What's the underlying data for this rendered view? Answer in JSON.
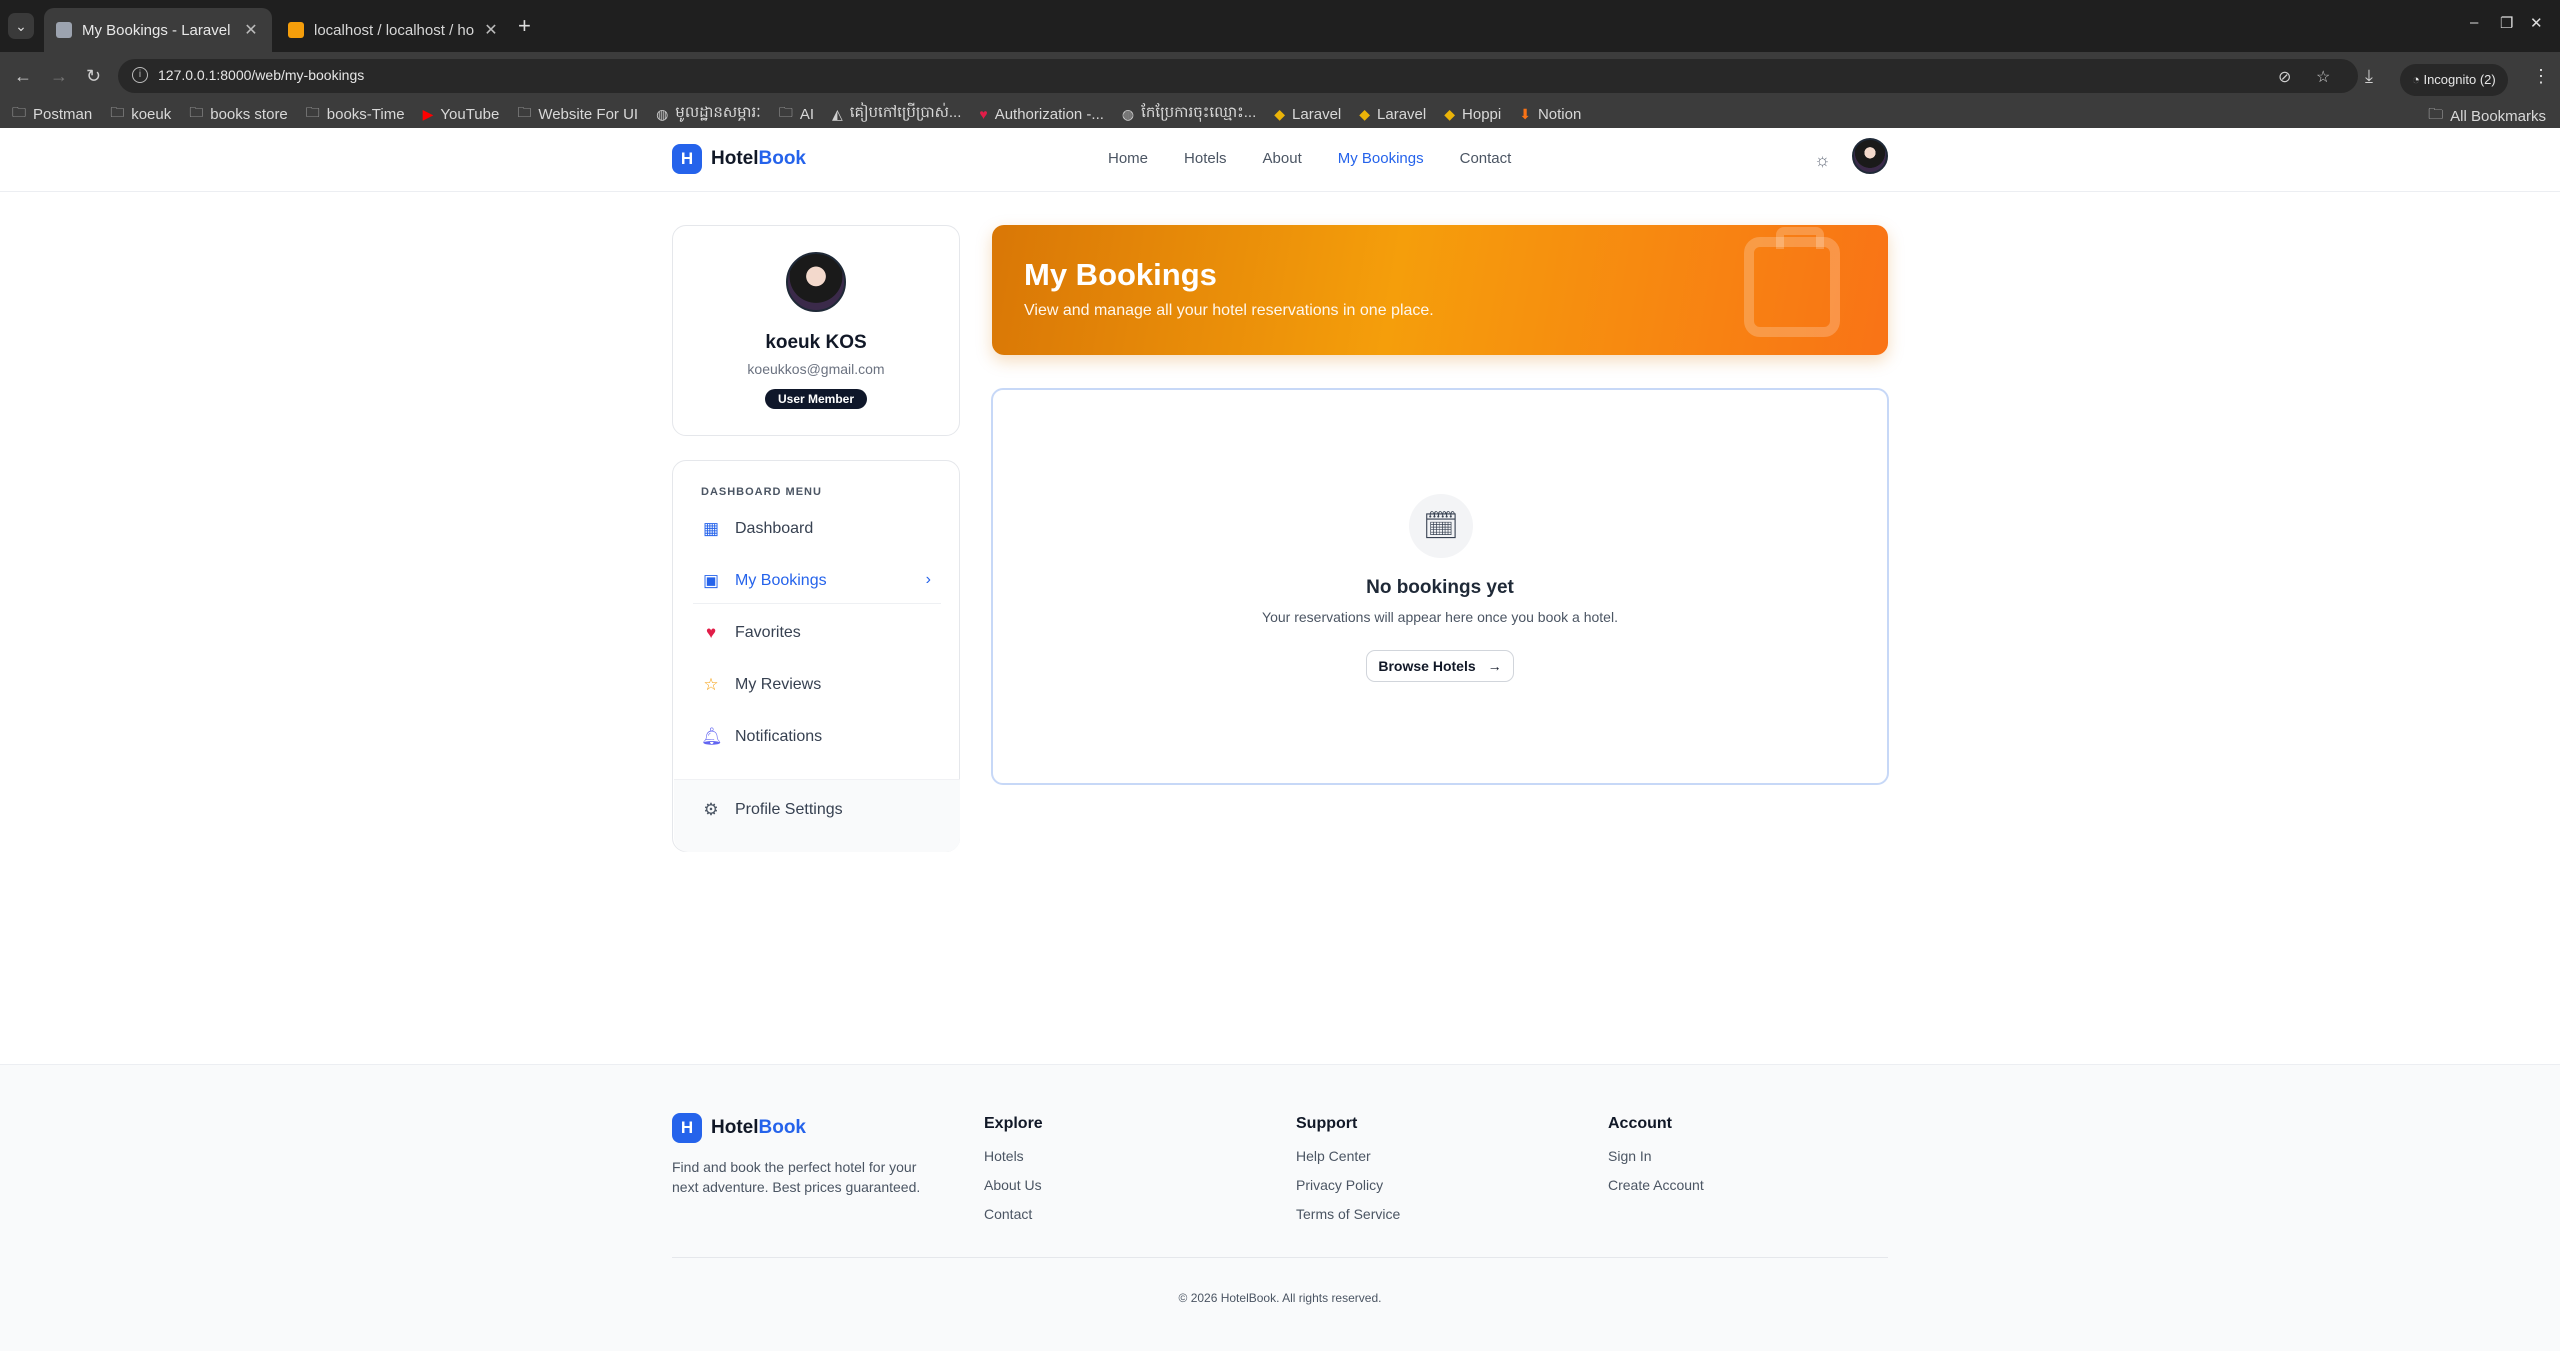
{
  "browser": {
    "tabs": [
      {
        "title": "My Bookings - Laravel",
        "active": true
      },
      {
        "title": "localhost / localhost / ho",
        "active": false
      }
    ],
    "url": "127.0.0.1:8000/web/my-bookings",
    "incognito_label": "Incognito (2)",
    "bookmarks": [
      {
        "label": "Postman",
        "icon": "folder-icon"
      },
      {
        "label": "koeuk",
        "icon": "folder-icon"
      },
      {
        "label": "books store",
        "icon": "folder-icon"
      },
      {
        "label": "books-Time",
        "icon": "folder-icon"
      },
      {
        "label": "YouTube",
        "icon": "youtube-icon"
      },
      {
        "label": "Website For UI",
        "icon": "folder-icon"
      },
      {
        "label": "មូលដ្ឋានសម្ភារៈ",
        "icon": "globe-icon"
      },
      {
        "label": "AI",
        "icon": "folder-icon"
      },
      {
        "label": "គៀបកៅប្រើប្រាស់...",
        "icon": "drive-icon"
      },
      {
        "label": "Authorization -...",
        "icon": "heart-icon"
      },
      {
        "label": "កែប្រែការចុះឈ្មោះ...",
        "icon": "globe-icon"
      },
      {
        "label": "Laravel",
        "icon": "laravel-icon"
      },
      {
        "label": "Laravel",
        "icon": "laravel-icon"
      },
      {
        "label": "Hoppi",
        "icon": "laravel-icon"
      },
      {
        "label": "Notion",
        "icon": "download-icon"
      }
    ],
    "all_bookmarks_label": "All Bookmarks"
  },
  "header": {
    "logo_letter": "H",
    "logo_hotel": "Hotel",
    "logo_book": "Book",
    "nav": [
      {
        "label": "Home",
        "active": false
      },
      {
        "label": "Hotels",
        "active": false
      },
      {
        "label": "About",
        "active": false
      },
      {
        "label": "My Bookings",
        "active": true
      },
      {
        "label": "Contact",
        "active": false
      }
    ]
  },
  "profile": {
    "name": "koeuk KOS",
    "email": "koeukkos@gmail.com",
    "badge": "User Member"
  },
  "sidebar": {
    "heading": "DASHBOARD MENU",
    "items": [
      {
        "label": "Dashboard",
        "icon": "grid-icon",
        "icon_color": "#2563eb",
        "active": false
      },
      {
        "label": "My Bookings",
        "icon": "calendar-icon",
        "icon_color": "#2563eb",
        "active": true
      },
      {
        "label": "Favorites",
        "icon": "heart-icon",
        "icon_color": "#e11d48",
        "active": false
      },
      {
        "label": "My Reviews",
        "icon": "star-icon",
        "icon_color": "#f59e0b",
        "active": false
      },
      {
        "label": "Notifications",
        "icon": "bell-icon",
        "icon_color": "#6366f1",
        "active": false
      },
      {
        "label": "Profile Settings",
        "icon": "gear-icon",
        "icon_color": "#4b5563",
        "active": false
      }
    ]
  },
  "hero": {
    "title": "My Bookings",
    "subtitle": "View and manage all your hotel reservations in one place."
  },
  "empty_state": {
    "title": "No bookings yet",
    "text": "Your reservations will appear here once you book a hotel.",
    "button_label": "Browse Hotels"
  },
  "footer": {
    "description": "Find and book the perfect hotel for your next adventure. Best prices guaranteed.",
    "columns": [
      {
        "title": "Explore",
        "links": [
          "Hotels",
          "About Us",
          "Contact"
        ]
      },
      {
        "title": "Support",
        "links": [
          "Help Center",
          "Privacy Policy",
          "Terms of Service"
        ]
      },
      {
        "title": "Account",
        "links": [
          "Sign In",
          "Create Account"
        ]
      }
    ],
    "copyright": "© 2026 HotelBook. All rights reserved."
  },
  "colors": {
    "accent": "#2563eb",
    "hero_start": "#d97706",
    "hero_end": "#f97316"
  }
}
